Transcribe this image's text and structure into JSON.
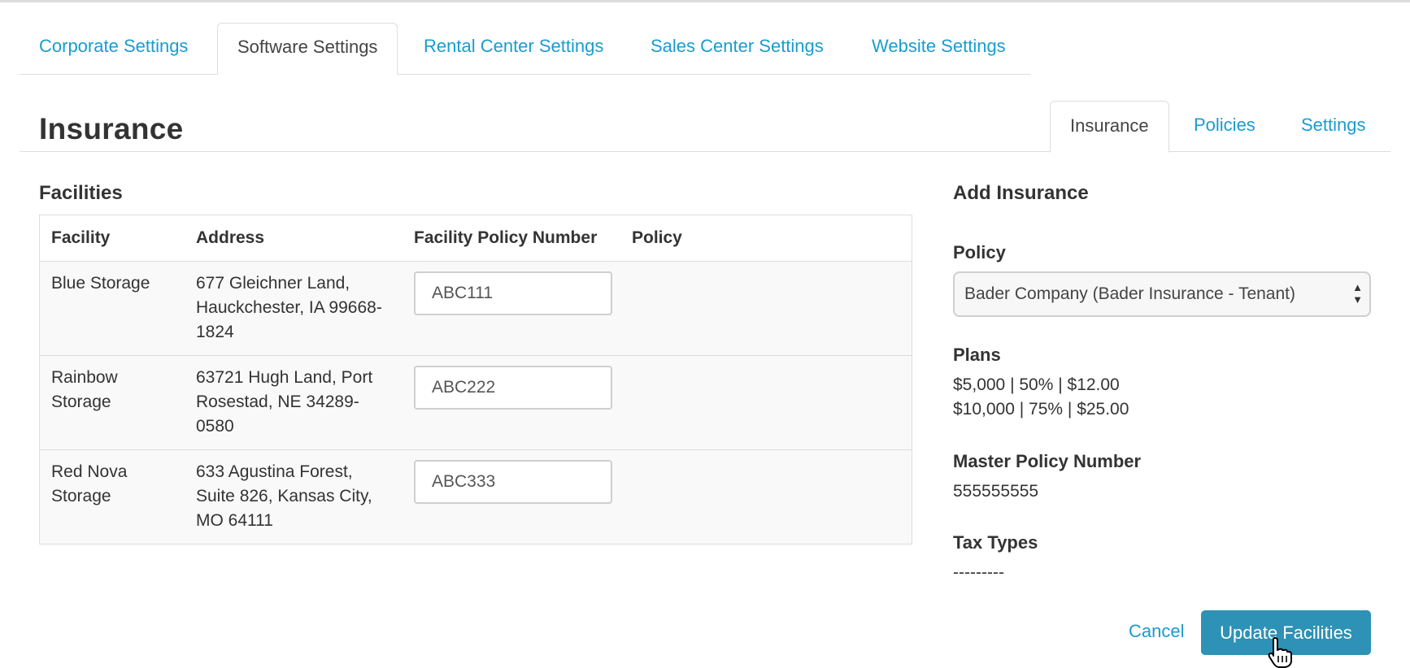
{
  "main_tabs": [
    {
      "label": "Corporate Settings",
      "active": false
    },
    {
      "label": "Software Settings",
      "active": true
    },
    {
      "label": "Rental Center Settings",
      "active": false
    },
    {
      "label": "Sales Center Settings",
      "active": false
    },
    {
      "label": "Website Settings",
      "active": false
    }
  ],
  "page": {
    "title": "Insurance"
  },
  "sub_tabs": [
    {
      "label": "Insurance",
      "active": true
    },
    {
      "label": "Policies",
      "active": false
    },
    {
      "label": "Settings",
      "active": false
    }
  ],
  "facilities": {
    "title": "Facilities",
    "columns": [
      "Facility",
      "Address",
      "Facility Policy Number",
      "Policy"
    ],
    "rows": [
      {
        "facility": "Blue Storage",
        "address": "677 Gleichner Land, Hauckchester, IA 99668-1824",
        "policy_number": "ABC111",
        "policy": ""
      },
      {
        "facility": "Rainbow Storage",
        "address": "63721 Hugh Land, Port Rosestad, NE 34289-0580",
        "policy_number": "ABC222",
        "policy": ""
      },
      {
        "facility": "Red Nova Storage",
        "address": "633 Agustina Forest, Suite 826, Kansas City, MO 64111",
        "policy_number": "ABC333",
        "policy": ""
      }
    ]
  },
  "add_insurance": {
    "title": "Add Insurance",
    "policy_label": "Policy",
    "policy_selected": "Bader Company (Bader Insurance - Tenant)",
    "plans_label": "Plans",
    "plans": [
      "$5,000 | 50% | $12.00",
      "$10,000 | 75% | $25.00"
    ],
    "master_policy_label": "Master Policy Number",
    "master_policy_value": "555555555",
    "tax_types_label": "Tax Types",
    "tax_types_value": "---------"
  },
  "actions": {
    "cancel_label": "Cancel",
    "update_label": "Update Facilities"
  },
  "colors": {
    "link": "#1a9ccf",
    "primary_button": "#2d92b5",
    "border": "#dddddd"
  }
}
